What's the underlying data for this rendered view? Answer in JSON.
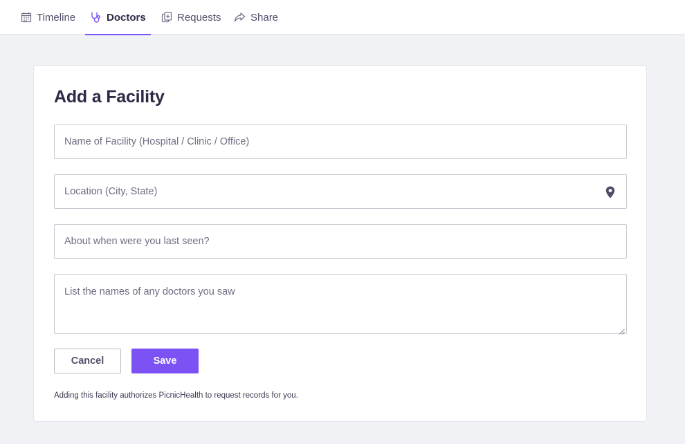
{
  "nav": {
    "tabs": [
      {
        "label": "Timeline",
        "icon": "calendar-icon",
        "active": false
      },
      {
        "label": "Doctors",
        "icon": "stethoscope-icon",
        "active": true
      },
      {
        "label": "Requests",
        "icon": "document-add-icon",
        "active": false
      },
      {
        "label": "Share",
        "icon": "share-arrow-icon",
        "active": false
      }
    ]
  },
  "form": {
    "title": "Add a Facility",
    "facility_name": {
      "placeholder": "Name of Facility (Hospital / Clinic / Office)",
      "value": ""
    },
    "location": {
      "placeholder": "Location (City, State)",
      "value": "",
      "icon": "map-pin-icon"
    },
    "last_seen": {
      "placeholder": "About when were you last seen?",
      "value": ""
    },
    "doctors": {
      "placeholder": "List the names of any doctors you saw",
      "value": ""
    },
    "cancel_label": "Cancel",
    "save_label": "Save",
    "disclaimer": "Adding this facility authorizes PicnicHealth to request records for you."
  },
  "colors": {
    "accent": "#7c52f5",
    "page_background": "#f1f2f6",
    "title_text": "#2d2a45"
  }
}
